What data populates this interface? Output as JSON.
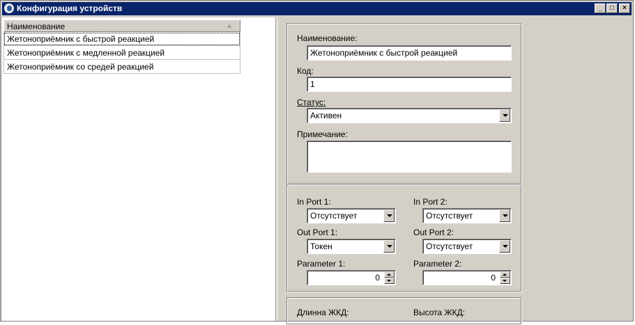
{
  "window": {
    "title": "Конфигурация устройств",
    "buttons": {
      "minimize": "_",
      "maximize": "□",
      "close": "×"
    }
  },
  "list": {
    "header": "Наименование",
    "rows": [
      "Жетоноприёмник с быстрой реакцией",
      "Жетоноприёмник с медленной реакцией",
      "Жетоноприёмник со средей реакцией"
    ]
  },
  "details": {
    "name_label": "Наименование:",
    "name_value": "Жетоноприёмник с быстрой реакцией",
    "code_label": "Код:",
    "code_value": "1",
    "status_label": "Статус:",
    "status_value": "Активен",
    "note_label": "Примечание:",
    "note_value": ""
  },
  "ports": {
    "in1_label": "In Port 1:",
    "in1_value": "Отсутствует",
    "in2_label": "In Port 2:",
    "in2_value": "Отсутствует",
    "out1_label": "Out Port 1:",
    "out1_value": "Токен",
    "out2_label": "Out Port 2:",
    "out2_value": "Отсутствует",
    "param1_label": "Parameter 1:",
    "param1_value": "0",
    "param2_label": "Parameter 2:",
    "param2_value": "0"
  },
  "lcd": {
    "length_label": "Длинна ЖКД:",
    "height_label": "Высота ЖКД:"
  }
}
